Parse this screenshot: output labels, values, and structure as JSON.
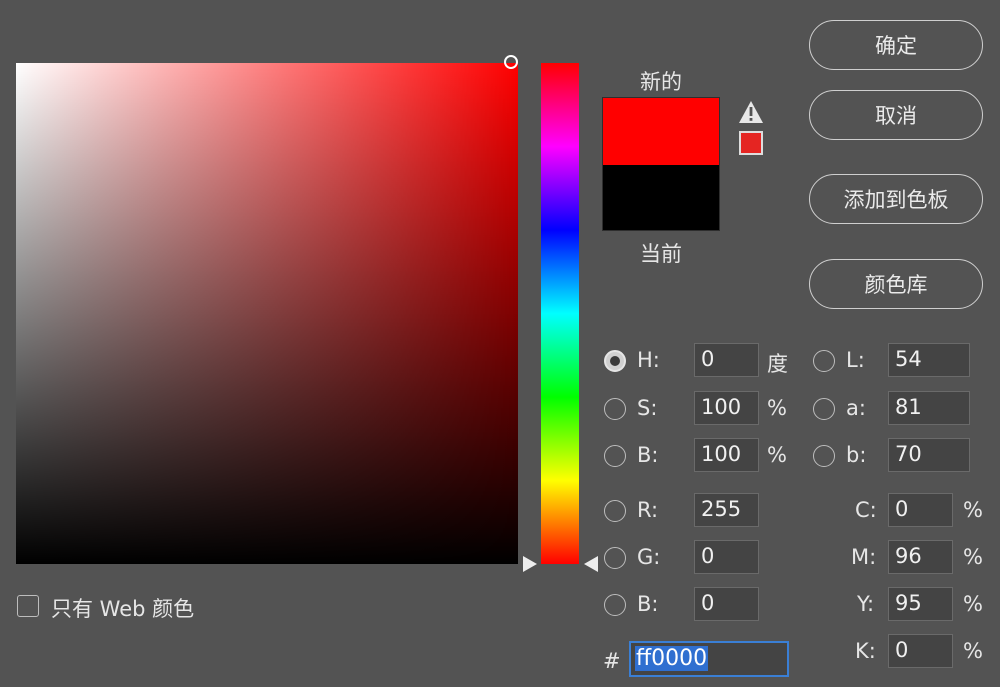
{
  "swatch": {
    "new_label": "新的",
    "current_label": "当前",
    "new_color": "#ff0000",
    "current_color": "#000000",
    "gamut_color": "#e52522"
  },
  "buttons": {
    "ok": "确定",
    "cancel": "取消",
    "add_to_swatches": "添加到色板",
    "color_library": "颜色库"
  },
  "hsb": {
    "h": {
      "label": "H:",
      "value": "0",
      "unit": "度"
    },
    "s": {
      "label": "S:",
      "value": "100",
      "unit": "%"
    },
    "b": {
      "label": "B:",
      "value": "100",
      "unit": "%"
    }
  },
  "rgb": {
    "r": {
      "label": "R:",
      "value": "255"
    },
    "g": {
      "label": "G:",
      "value": "0"
    },
    "b": {
      "label": "B:",
      "value": "0"
    }
  },
  "lab": {
    "l": {
      "label": "L:",
      "value": "54"
    },
    "a": {
      "label": "a:",
      "value": "81"
    },
    "b": {
      "label": "b:",
      "value": "70"
    }
  },
  "cmyk": {
    "c": {
      "label": "C:",
      "value": "0",
      "unit": "%"
    },
    "m": {
      "label": "M:",
      "value": "96",
      "unit": "%"
    },
    "y": {
      "label": "Y:",
      "value": "95",
      "unit": "%"
    },
    "k": {
      "label": "K:",
      "value": "0",
      "unit": "%"
    }
  },
  "hex": {
    "prefix": "#",
    "value": "ff0000"
  },
  "web_only": {
    "label": "只有 Web 颜色",
    "checked": false
  },
  "selected_mode": "H",
  "icons": {
    "gamut_warning": "warning-icon"
  }
}
